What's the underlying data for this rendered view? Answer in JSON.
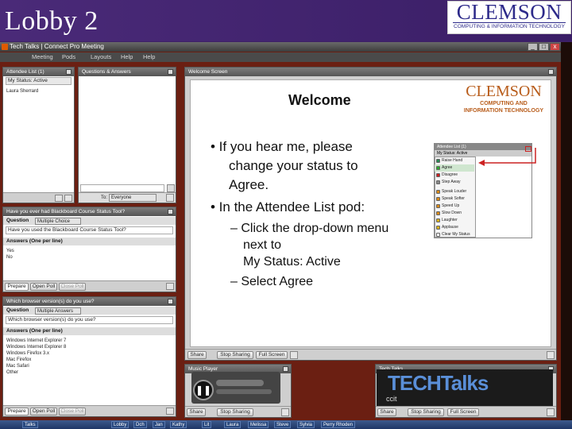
{
  "slide": {
    "title": "Lobby 2",
    "logo_big": "CLEMSON",
    "logo_small": "COMPUTING & INFORMATION TECHNOLOGY"
  },
  "window": {
    "title": "Tech Talks | Connect Pro Meeting",
    "min": "_",
    "max": "□",
    "close": "x"
  },
  "menu": [
    "Meeting",
    "Pods",
    "Layouts",
    "Help",
    "Help"
  ],
  "attendee_pod": {
    "title": "Attendee List (1)",
    "status": "My Status: Active",
    "rows": [
      "Laura Sherrard"
    ]
  },
  "chat_pod": {
    "title": "Questions & Answers",
    "to_label": "To:",
    "to_value": "Everyone"
  },
  "poll1": {
    "title": "Have you ever had Blackboard Course Status Tool?",
    "question_label": "Question",
    "type": "Multiple Choice",
    "question": "Have you used the Blackboard Course Status Tool?",
    "answers_label": "Answers (One per line)",
    "answers": [
      "Yes",
      "No"
    ],
    "buttons": [
      "Prepare",
      "Open Poll",
      "Close Poll"
    ]
  },
  "poll2": {
    "title": "Which browser version(s) do you use?",
    "question_label": "Question",
    "type": "Multiple Answers",
    "question": "Which browser version(s) do you use?",
    "answers_label": "Answers (One per line)",
    "answers": [
      "Windows Internet Explorer 7",
      "Windows Internet Explorer 8",
      "Windows Firefox 3.x",
      "Mac Firefox",
      "Mac Safari",
      "Other"
    ],
    "buttons": [
      "Prepare",
      "Open Poll",
      "Close Poll"
    ]
  },
  "share_pod": {
    "title": "Welcome Screen",
    "toolbar": [
      "Share",
      "Stop Sharing",
      "Full Screen"
    ]
  },
  "content": {
    "welcome": "Welcome",
    "logo_big": "CLEMSON",
    "logo_small1": "COMPUTING AND",
    "logo_small2": "INFORMATION TECHNOLOGY",
    "bullet1_lines": [
      "• If you hear me, please",
      "change your status to",
      "Agree."
    ],
    "bullet2": "• In the Attendee List pod:",
    "sub1_lines": [
      "– Click the drop-down menu",
      "next to",
      "My Status: Active"
    ],
    "sub2": "– Select Agree",
    "dropdown": {
      "head": "Attendee List (1)",
      "status": "My Status: Active",
      "items": [
        {
          "label": "Raise Hand",
          "color": "#2e8b57"
        },
        {
          "label": "Agree",
          "color": "#2eaa2e"
        },
        {
          "label": "Disagree",
          "color": "#cc2222"
        },
        {
          "label": "Step Away",
          "color": "#888888"
        },
        {
          "label": "Speak Louder",
          "color": "#d88a1a"
        },
        {
          "label": "Speak Softer",
          "color": "#d88a1a"
        },
        {
          "label": "Speed Up",
          "color": "#d88a1a"
        },
        {
          "label": "Slow Down",
          "color": "#d88a1a"
        },
        {
          "label": "Laughter",
          "color": "#d8b01a"
        },
        {
          "label": "Applause",
          "color": "#d8b01a"
        },
        {
          "label": "Clear My Status",
          "color": "#ffffff"
        }
      ]
    }
  },
  "audio_pod": {
    "title": "Music Player",
    "toolbar": [
      "Share",
      "Stop Sharing"
    ]
  },
  "image_pod": {
    "title": "Tech Talks",
    "image_text": "TECHTalks",
    "badge": "ccit",
    "toolbar": [
      "Share",
      "Stop Sharing",
      "Full Screen"
    ]
  },
  "taskbar": [
    "Talks",
    "Lobby",
    "Dch",
    "Jan",
    "Kathy",
    "Lit",
    "Laura",
    "Melissa",
    "Steve",
    "Sylvia",
    "Perry Rhoden"
  ]
}
